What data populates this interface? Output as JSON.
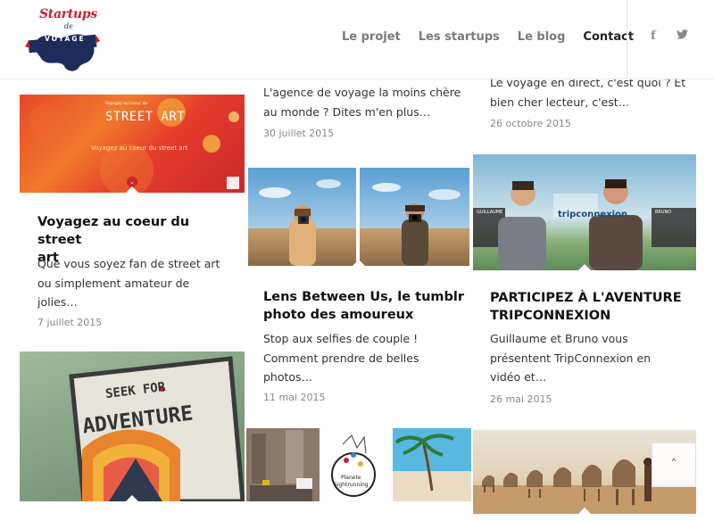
{
  "site": {
    "logo_script": "Startups",
    "logo_de": "de",
    "logo_banner": "VOYAGE"
  },
  "nav": {
    "items": [
      {
        "label": "Le projet",
        "active": false
      },
      {
        "label": "Les startups",
        "active": false
      },
      {
        "label": "Le blog",
        "active": false
      },
      {
        "label": "Contact",
        "active": true
      }
    ]
  },
  "social": {
    "facebook": "f",
    "twitter": "𝕥"
  },
  "posts": {
    "p_top_mid": {
      "excerpt_lines": [
        "L'agence de voyage la moins chère",
        "au monde ? Dites m'en plus…"
      ],
      "date": "30 juillet 2015"
    },
    "p_top_right": {
      "excerpt_lines": [
        "Le voyage en direct, c'est quoi ? Et",
        "bien cher lecteur, c'est…"
      ],
      "date": "26 octobre 2015"
    },
    "p_street_art": {
      "image_caption_small": "Voyagez au coeur du",
      "image_caption_big": "STREET ART",
      "image_caption_sub": "Voyagez au coeur du street art",
      "title_lines": [
        "Voyagez au coeur du street",
        "art"
      ],
      "excerpt_lines": [
        "Que vous soyez fan de street art",
        "ou simplement amateur de",
        "jolies…"
      ],
      "date": "7 juillet 2015"
    },
    "p_lens": {
      "title_lines": [
        "Lens Between Us, le tumblr",
        "photo des amoureux"
      ],
      "excerpt_lines": [
        "Stop aux selfies de couple !",
        "Comment prendre de belles",
        "photos…"
      ],
      "date": "11 mai 2015"
    },
    "p_tripconnexion": {
      "image_label_left": "GUILLAUME",
      "image_label_right": "BRUNO",
      "image_brand": "tripconnexion",
      "title_lines": [
        "PARTICIPEZ À L'AVENTURE",
        "TRIPCONNEXION"
      ],
      "excerpt_lines": [
        "Guillaume et Bruno vous",
        "présentent TripConnexion en",
        "vidéo et…"
      ],
      "date": "26 mai 2015"
    },
    "p_adventure": {
      "image_text_top": "SEEK FOR",
      "image_text_main": "ADVENTURE"
    },
    "p_planete": {
      "image_text_1": "Planete",
      "image_text_2": "Sightrunning"
    }
  },
  "scrolltop": {
    "label": "˄"
  },
  "colors": {
    "accent_red": "#c8202f",
    "navy": "#1e2c5c",
    "nav_text": "#7a7a7a",
    "nav_active": "#222222"
  }
}
